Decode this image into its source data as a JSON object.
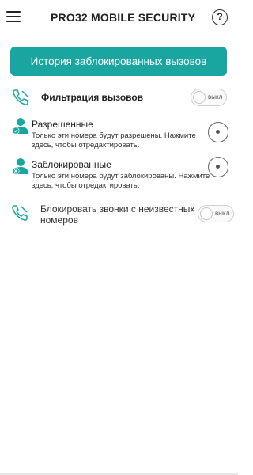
{
  "header": {
    "brand_prefix": "PRO32",
    "brand_suffix": " MOBILE SECURITY",
    "help_label": "?"
  },
  "history_button": {
    "label": "История заблокированных вызовов"
  },
  "call_filter": {
    "label": "Фильтрация вызовов",
    "toggle": "выкл",
    "enabled": false
  },
  "allowed": {
    "title": "Разрешенные",
    "description": "Только эти номера будут разрешены. Нажмите здесь, чтобы отредактировать."
  },
  "blocked": {
    "title": "Заблокированные",
    "description": "Только эти номера будут заблокированы. Нажмите здесь, чтобы отредактировать."
  },
  "unknown": {
    "label": "Блокировать звонки с неизвестных номеров",
    "toggle": "выкл",
    "enabled": false
  },
  "colors": {
    "accent": "#1aa6a0",
    "icon": "#1aa6a0"
  },
  "icons": {
    "menu": "hamburger-menu-icon",
    "help": "help-icon",
    "filter": "phone-filter-icon",
    "allowed": "user-allowed-icon",
    "blocked": "user-blocked-icon",
    "unknown": "phone-unknown-icon"
  }
}
